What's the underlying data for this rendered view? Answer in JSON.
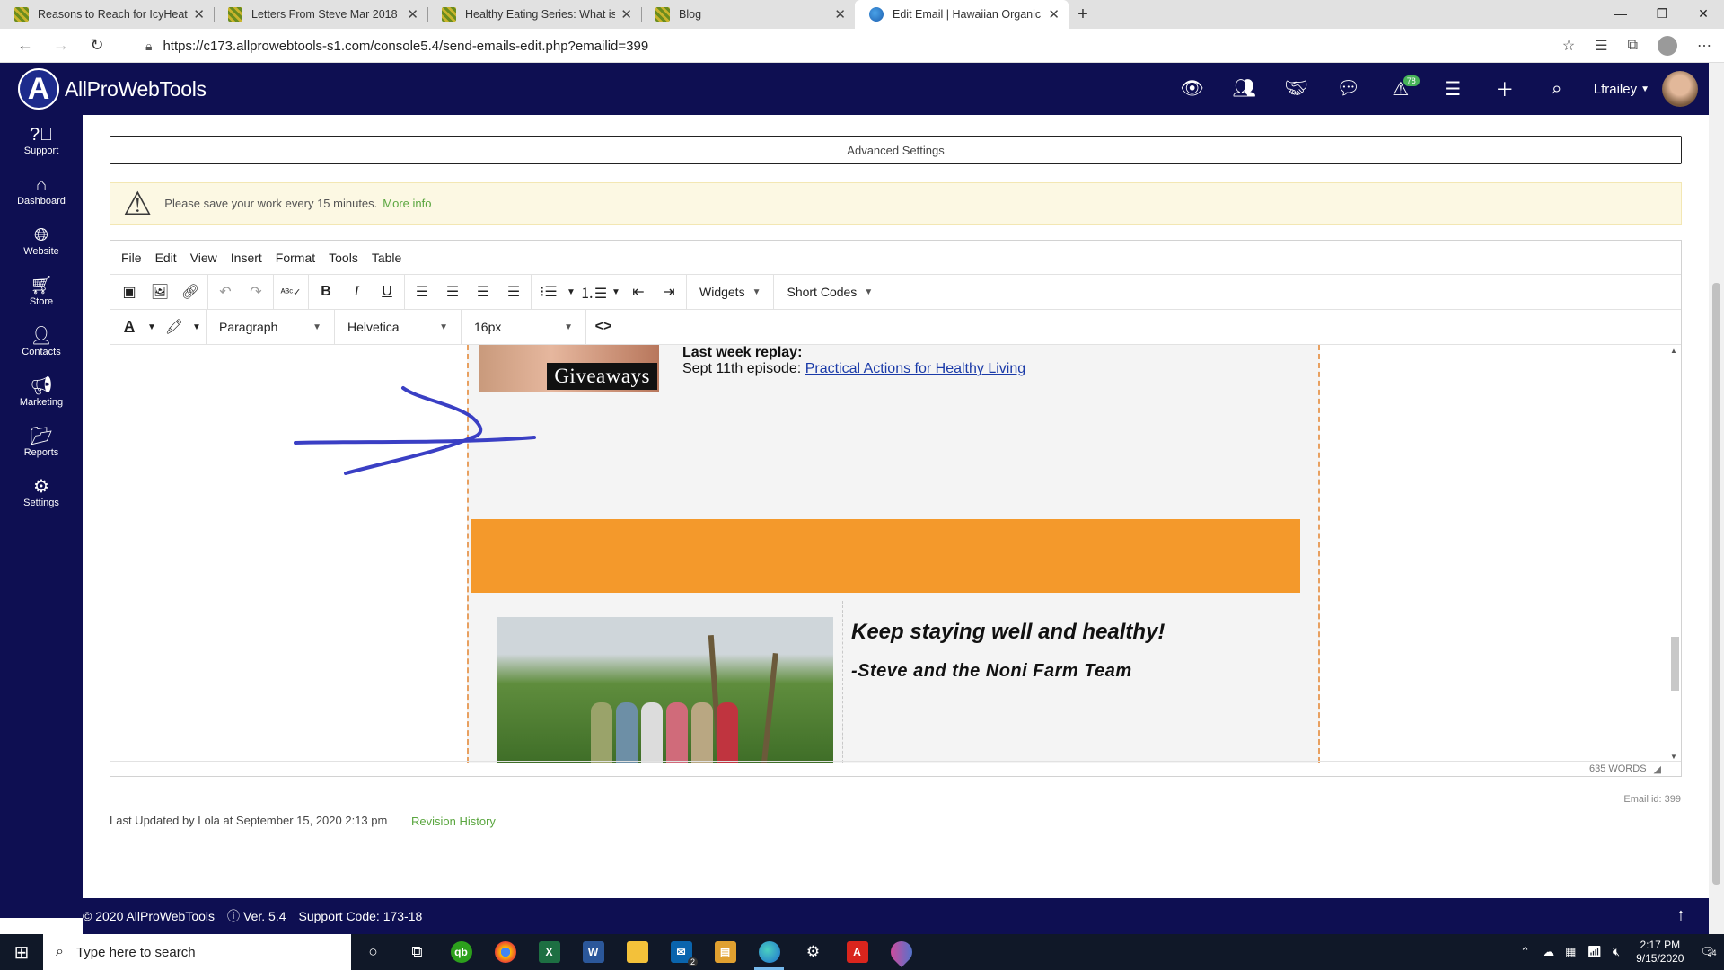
{
  "browser": {
    "tabs": [
      {
        "title": "Reasons to Reach for IcyHeat No",
        "active": false
      },
      {
        "title": "Letters From Steve Mar 2018",
        "active": false
      },
      {
        "title": "Healthy Eating Series: What is a",
        "active": false
      },
      {
        "title": "Blog",
        "active": false
      },
      {
        "title": "Edit Email | Hawaiian Organic No",
        "active": true
      }
    ],
    "url": "https://c173.allprowebtools-s1.com/console5.4/send-emails-edit.php?emailid=399"
  },
  "app": {
    "logo_text": "AllProWebTools",
    "notification_count": "78",
    "username": "Lfrailey"
  },
  "sidebar": {
    "items": [
      {
        "label": "Support",
        "icon": "question-icon"
      },
      {
        "label": "Dashboard",
        "icon": "home-icon"
      },
      {
        "label": "Website",
        "icon": "globe-icon"
      },
      {
        "label": "Store",
        "icon": "cart-icon"
      },
      {
        "label": "Contacts",
        "icon": "user-icon"
      },
      {
        "label": "Marketing",
        "icon": "megaphone-icon"
      },
      {
        "label": "Reports",
        "icon": "folder-icon"
      },
      {
        "label": "Settings",
        "icon": "gear-icon"
      }
    ]
  },
  "page": {
    "advanced_settings": "Advanced Settings",
    "warning_text": "Please save your work every 15 minutes.",
    "warning_link": "More info",
    "word_count": "635 WORDS",
    "email_id": "Email id: 399",
    "last_updated": "Last Updated by Lola at September 15, 2020 2:13 pm",
    "revision_history": "Revision History"
  },
  "editor": {
    "menu": [
      "File",
      "Edit",
      "View",
      "Insert",
      "Format",
      "Tools",
      "Table"
    ],
    "widgets_label": "Widgets",
    "shortcodes_label": "Short Codes",
    "block_format": "Paragraph",
    "font_family": "Helvetica",
    "font_size": "16px"
  },
  "email_content": {
    "giveaways_label": "Giveaways",
    "replay_heading": "Last week replay:",
    "replay_text": "Sept 11th episode: ",
    "replay_link": "Practical Actions for Healthy Living",
    "closing": "Keep staying well and healthy!",
    "signature": "-Steve and the Noni Farm Team"
  },
  "footer": {
    "copyright": "© 2020 AllProWebTools",
    "version": "Ver. 5.4",
    "support_code": "Support Code: 173-18"
  },
  "taskbar": {
    "search_placeholder": "Type here to search",
    "time": "2:17 PM",
    "date": "9/15/2020",
    "notifications": "24",
    "mail_badge": "2"
  },
  "colors": {
    "nav_bg": "#0e0f52",
    "accent_green": "#5aa63f",
    "orange_band": "#f4992b",
    "annotation_arrow": "#3a3fc4"
  }
}
